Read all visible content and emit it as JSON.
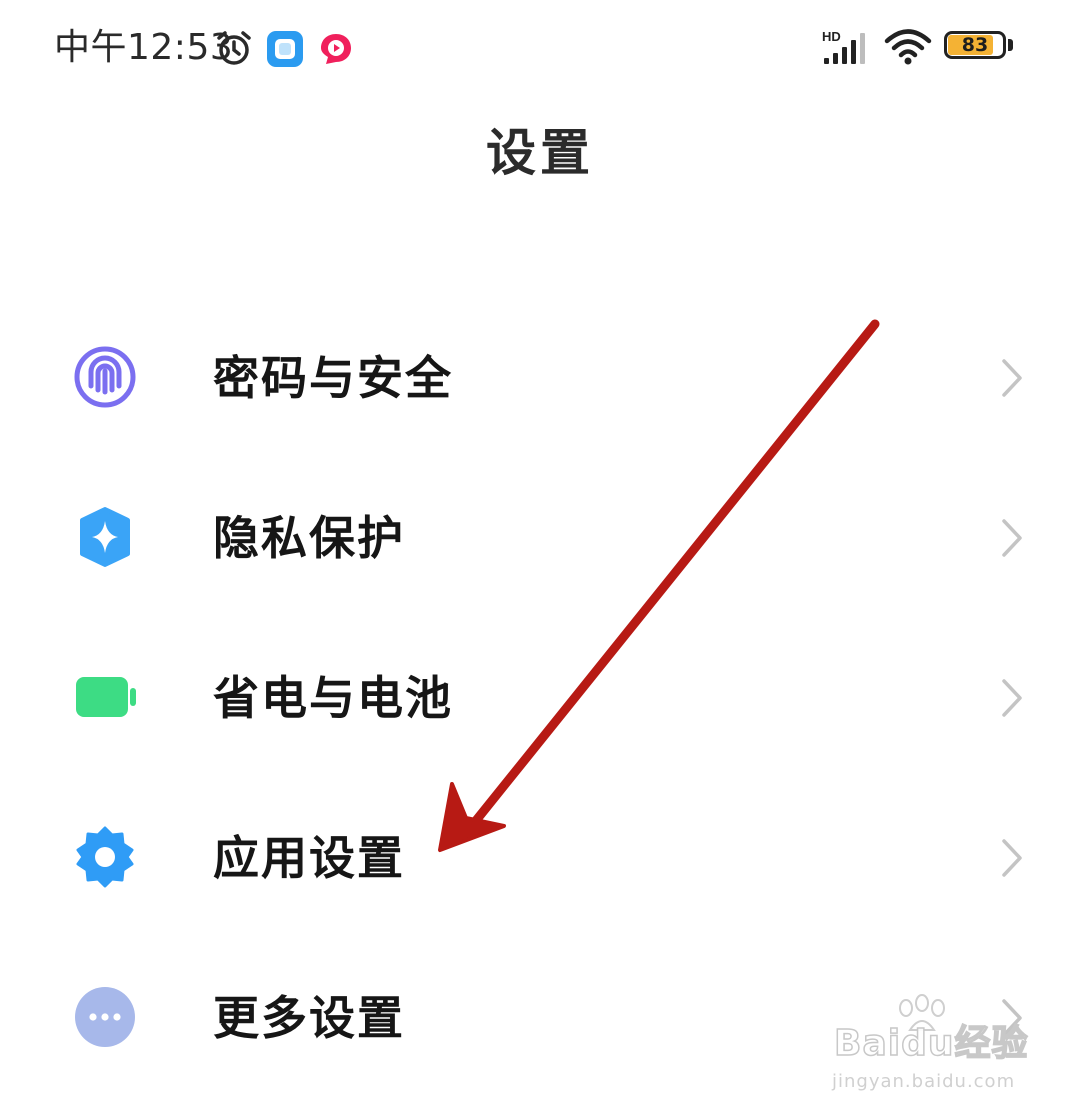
{
  "status_bar": {
    "time": "中午12:53",
    "network_label": "HD",
    "battery_level": 83,
    "battery_text": "83",
    "icons": [
      "alarm-clock-icon",
      "notes-app-icon",
      "video-app-icon",
      "cellular-signal-icon",
      "wifi-icon",
      "battery-icon"
    ]
  },
  "page": {
    "title": "设置"
  },
  "settings": {
    "items": [
      {
        "label": "密码与安全",
        "icon": "fingerprint-icon",
        "icon_color": "#7b6ff0"
      },
      {
        "label": "隐私保护",
        "icon": "privacy-shield-icon",
        "icon_color": "#3aa4f7"
      },
      {
        "label": "省电与电池",
        "icon": "battery-icon",
        "icon_color": "#3ddc84"
      },
      {
        "label": "应用设置",
        "icon": "gear-icon",
        "icon_color": "#2f9cf6"
      },
      {
        "label": "更多设置",
        "icon": "more-dots-icon",
        "icon_color": "#a7b8ea"
      }
    ]
  },
  "annotation": {
    "arrow_color": "#b71a14",
    "points_to": "应用设置"
  },
  "watermark": {
    "logo_text": "Baidu经验",
    "url": "jingyan.baidu.com"
  }
}
